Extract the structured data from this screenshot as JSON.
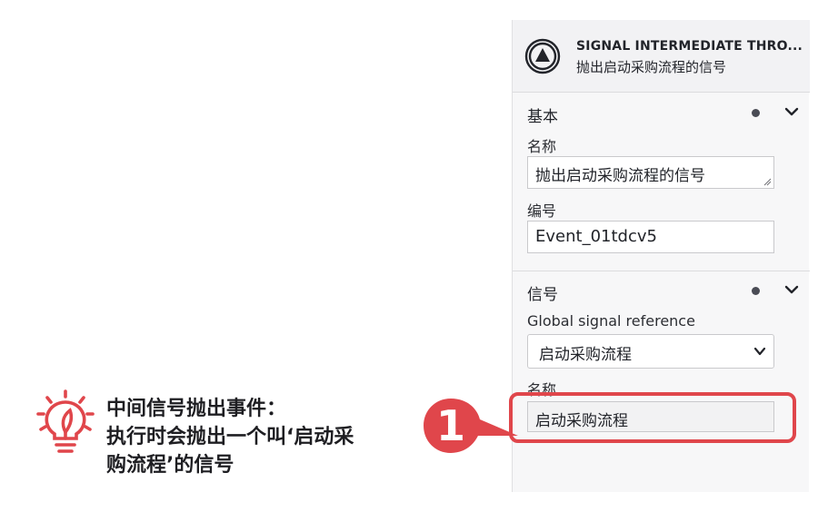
{
  "panel": {
    "header": {
      "title": "SIGNAL INTERMEDIATE THRO...",
      "subtitle": "抛出启动采购流程的信号",
      "icon": "signal-throw-event-icon"
    },
    "groups": [
      {
        "title": "基本",
        "fields": [
          {
            "label": "名称",
            "value": "抛出启动采购流程的信号"
          },
          {
            "label": "编号",
            "value": "Event_01tdcv5"
          }
        ]
      },
      {
        "title": "信号",
        "fields": [
          {
            "label": "Global signal reference",
            "value": "启动采购流程"
          },
          {
            "label": "名称",
            "value": "启动采购流程"
          }
        ]
      }
    ]
  },
  "annotation": {
    "step_number": "1",
    "note_lines": [
      "中间信号抛出事件：",
      "执行时会抛出一个叫‘启动采",
      "购流程’的信号"
    ],
    "accent_color": "#e0464b"
  }
}
